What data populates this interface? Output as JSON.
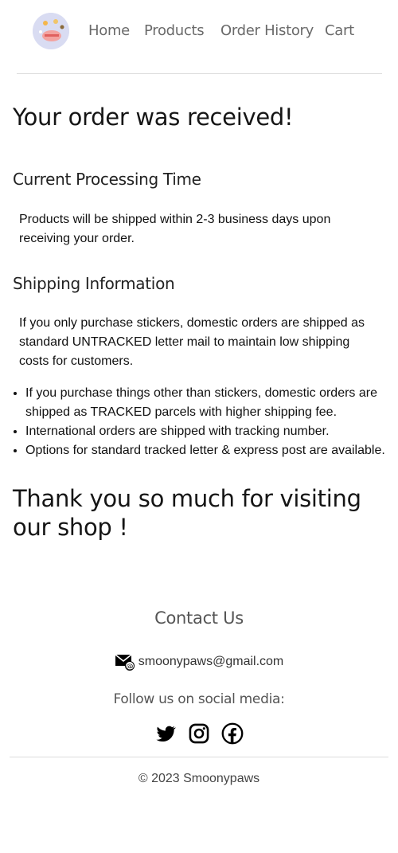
{
  "nav": {
    "logo_alt": "Smoonypaws logo",
    "links": [
      "Home",
      "Products",
      "Order History",
      "Cart"
    ]
  },
  "main": {
    "title": "Your order was received!",
    "processing_heading": "Current Processing Time",
    "processing_text": "Products will be shipped within 2-3 business days upon receiving your order.",
    "shipping_heading": "Shipping Information",
    "shipping_text": "If you only purchase stickers, domestic orders are shipped as standard UNTRACKED letter mail to maintain low shipping costs for customers.",
    "shipping_bullets": [
      "If you purchase things other than stickers, domestic orders are shipped as TRACKED parcels with higher shipping fee.",
      "International orders are shipped with tracking number.",
      "Options for standard tracked letter & express post are available."
    ],
    "thanks": "Thank you so much for visiting our shop !"
  },
  "footer": {
    "contact_title": "Contact Us",
    "email": "smoonypaws@gmail.com",
    "follow_text": "Follow us on social media:",
    "social_icons": [
      "twitter-icon",
      "instagram-icon",
      "facebook-icon"
    ],
    "copyright": "© 2023 Smoonypaws"
  }
}
